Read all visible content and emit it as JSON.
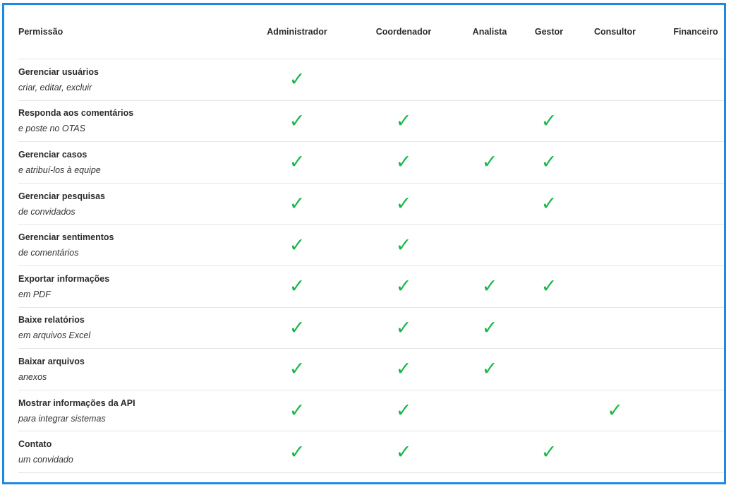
{
  "table": {
    "columns": {
      "permission": "Permissão",
      "roles": [
        "Administrador",
        "Coordenador",
        "Analista",
        "Gestor",
        "Consultor",
        "Financeiro"
      ]
    },
    "rows": [
      {
        "title": "Gerenciar usuários",
        "subtitle": "criar, editar, excluir",
        "checks": [
          true,
          false,
          false,
          false,
          false,
          false
        ]
      },
      {
        "title": "Responda aos comentários",
        "subtitle": "e poste no OTAS",
        "checks": [
          true,
          true,
          false,
          true,
          false,
          false
        ]
      },
      {
        "title": "Gerenciar casos",
        "subtitle": "e atribuí-los à equipe",
        "checks": [
          true,
          true,
          true,
          true,
          false,
          false
        ]
      },
      {
        "title": "Gerenciar pesquisas",
        "subtitle": "de convidados",
        "checks": [
          true,
          true,
          false,
          true,
          false,
          false
        ]
      },
      {
        "title": "Gerenciar sentimentos",
        "subtitle": "de comentários",
        "checks": [
          true,
          true,
          false,
          false,
          false,
          false
        ]
      },
      {
        "title": "Exportar informações",
        "subtitle": "em PDF",
        "checks": [
          true,
          true,
          true,
          true,
          false,
          false
        ]
      },
      {
        "title": "Baixe relatórios",
        "subtitle": "em arquivos Excel",
        "checks": [
          true,
          true,
          true,
          false,
          false,
          false
        ]
      },
      {
        "title": "Baixar arquivos",
        "subtitle": "anexos",
        "checks": [
          true,
          true,
          true,
          false,
          false,
          false
        ]
      },
      {
        "title": "Mostrar informações da API",
        "subtitle": "para integrar sistemas",
        "checks": [
          true,
          true,
          false,
          false,
          true,
          false
        ]
      },
      {
        "title": "Contato",
        "subtitle": "um convidado",
        "checks": [
          true,
          true,
          false,
          true,
          false,
          false
        ]
      }
    ],
    "check_glyph": "✓",
    "check_icon": "checkmark-icon",
    "check_color": "#1ab64a",
    "border_color": "#1e88e5"
  }
}
